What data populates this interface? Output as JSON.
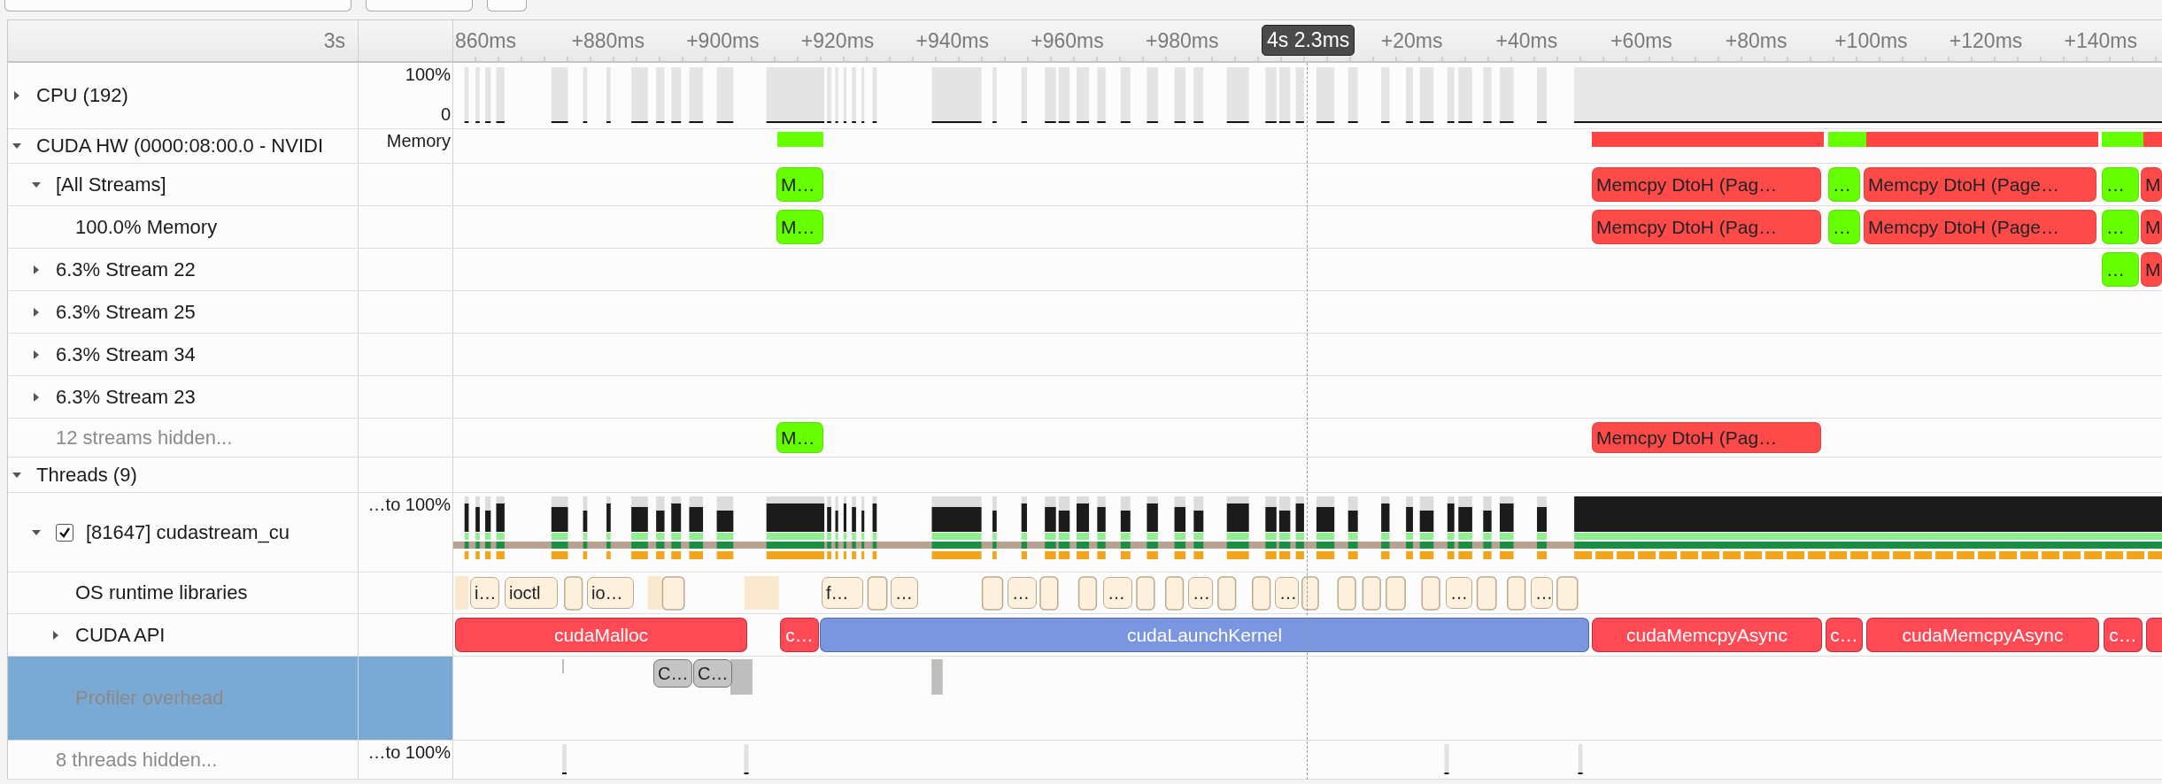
{
  "timeline": {
    "start_label": "3s",
    "ticks": [
      "860ms",
      "+880ms",
      "+900ms",
      "+920ms",
      "+940ms",
      "+960ms",
      "+980ms",
      "+20ms",
      "+40ms",
      "+60ms",
      "+80ms",
      "+100ms",
      "+120ms",
      "+140ms"
    ],
    "cursor": "4s 2.3ms"
  },
  "tracks": [
    {
      "label": "CPU (192)",
      "kind": "cpu",
      "expanded": false,
      "selected": false,
      "scale": [
        "100%",
        "0"
      ]
    },
    {
      "label": "CUDA HW (0000:08:00.0 - NVIDI",
      "kind": "device",
      "expanded": true,
      "selected": false,
      "side": "Memory",
      "segments": [
        {
          "color": "#66ff00"
        },
        {
          "color": "#ff4444"
        },
        {
          "color": "#66ff00"
        },
        {
          "color": "#ff4444"
        },
        {
          "color": "#66ff00"
        },
        {
          "color": "#ff4444"
        }
      ],
      "children": [
        {
          "label": "[All Streams]",
          "kind": "stream",
          "expanded": true,
          "selected": false,
          "events": [
            {
              "label": "M…",
              "color": "#66ff00"
            },
            {
              "label": "Memcpy DtoH (Pag…",
              "color": "#ff4a4a"
            },
            {
              "label": "…",
              "color": "#66ff00"
            },
            {
              "label": "Memcpy DtoH (Page…",
              "color": "#ff4a4a"
            },
            {
              "label": "…",
              "color": "#66ff00"
            },
            {
              "label": "M",
              "color": "#ff4a4a"
            }
          ],
          "children": [
            {
              "label": "100.0% Memory",
              "kind": "stream",
              "selected": false,
              "events": [
                {
                  "label": "M…",
                  "color": "#66ff00"
                },
                {
                  "label": "Memcpy DtoH (Pag…",
                  "color": "#ff4a4a"
                },
                {
                  "label": "…",
                  "color": "#66ff00"
                },
                {
                  "label": "Memcpy DtoH (Page…",
                  "color": "#ff4a4a"
                },
                {
                  "label": "…",
                  "color": "#66ff00"
                },
                {
                  "label": "M",
                  "color": "#ff4a4a"
                }
              ]
            }
          ]
        },
        {
          "label": "6.3% Stream 22",
          "kind": "stream",
          "expanded": false,
          "selected": false,
          "events": [
            {
              "label": "…",
              "color": "#66ff00"
            },
            {
              "label": "M",
              "color": "#ff4a4a"
            }
          ]
        },
        {
          "label": "6.3% Stream 25",
          "kind": "stream",
          "expanded": false,
          "selected": false
        },
        {
          "label": "6.3% Stream 34",
          "kind": "stream",
          "expanded": false,
          "selected": false
        },
        {
          "label": "6.3% Stream 23",
          "kind": "stream",
          "expanded": false,
          "selected": false
        },
        {
          "label": "12 streams hidden...",
          "kind": "hidden",
          "selected": false,
          "events": [
            {
              "label": "M…",
              "color": "#66ff00"
            },
            {
              "label": "Memcpy DtoH (Pag…",
              "color": "#ff4a4a"
            }
          ]
        }
      ]
    },
    {
      "label": "Threads (9)",
      "kind": "group",
      "expanded": true,
      "selected": false,
      "children": [
        {
          "label": "[81647] cudastream_cu",
          "kind": "thread",
          "expanded": true,
          "checked": true,
          "selected": false,
          "side": "…to 100%",
          "children": [
            {
              "label": "OS runtime libraries",
              "kind": "osrt",
              "selected": false,
              "events": [
                {
                  "label": "i…"
                },
                {
                  "label": "ioctl"
                },
                {
                  "label": "io…"
                },
                {
                  "label": "f…"
                },
                {
                  "label": "…"
                },
                {
                  "label": "…"
                },
                {
                  "label": "…"
                },
                {
                  "label": "…"
                },
                {
                  "label": "…"
                },
                {
                  "label": "…"
                },
                {
                  "label": "…"
                }
              ]
            },
            {
              "label": "CUDA API",
              "kind": "api",
              "expanded": false,
              "selected": false,
              "events": [
                {
                  "label": "cudaMalloc",
                  "color": "#ff4a55"
                },
                {
                  "label": "c…",
                  "color": "#ff4a55"
                },
                {
                  "label": "cudaLaunchKernel",
                  "color": "#7b96e0"
                },
                {
                  "label": "cudaMemcpyAsync",
                  "color": "#ff4a55"
                },
                {
                  "label": "c…",
                  "color": "#ff4a55"
                },
                {
                  "label": "cudaMemcpyAsync",
                  "color": "#ff4a55"
                },
                {
                  "label": "c…",
                  "color": "#ff4a55"
                },
                {
                  "color": "#ff4a55"
                }
              ]
            },
            {
              "label": "Profiler overhead",
              "kind": "overhead",
              "selected": true,
              "events": [
                {
                  "label": "C…",
                  "color": "#c4c4c4"
                },
                {
                  "label": "C…",
                  "color": "#c4c4c4"
                }
              ]
            }
          ]
        },
        {
          "label": "8 threads hidden...",
          "kind": "hidden",
          "selected": false,
          "side": "…to 100%"
        }
      ]
    }
  ]
}
